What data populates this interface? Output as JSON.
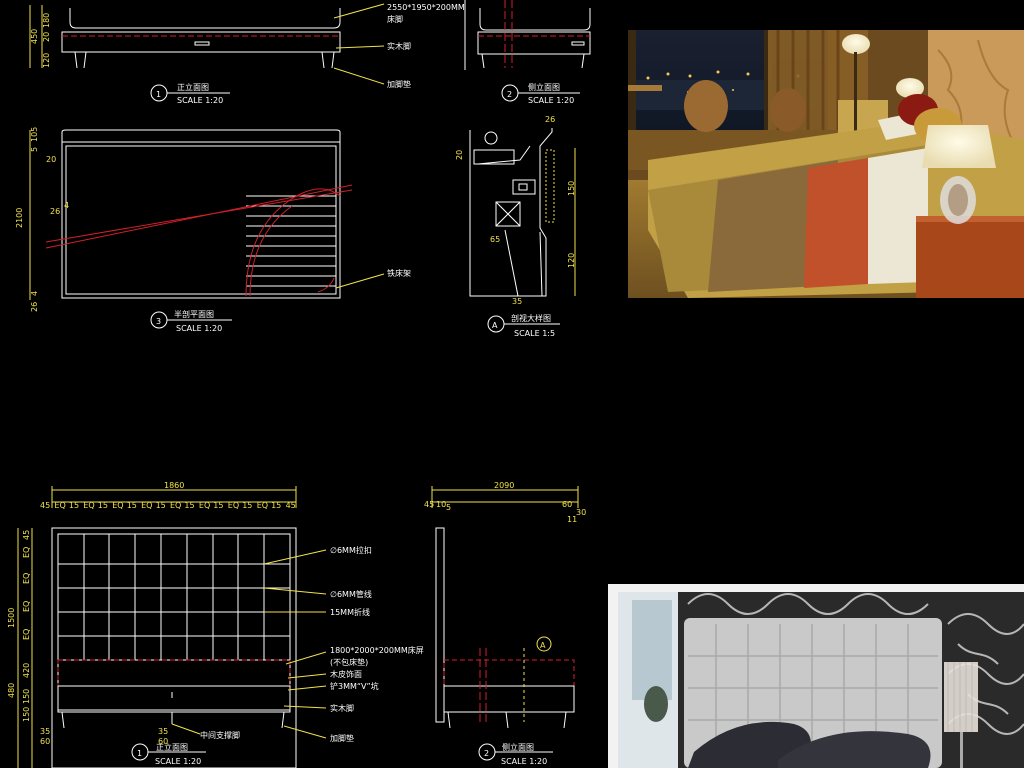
{
  "top_cad": {
    "dims_left_top": [
      "450",
      "120",
      "180",
      "20"
    ],
    "dims_left_mid": [
      "5",
      "105",
      "20",
      "2100",
      "26",
      "4",
      "26",
      "4"
    ],
    "callouts": {
      "size": "2550*1950*200MM",
      "foot": "床脚",
      "solid_leg": "实木脚",
      "pad": "加脚垫",
      "iron_frame": "铁床架"
    },
    "titles": [
      {
        "num": "1",
        "name": "正立面图",
        "scale": "SCALE 1:20"
      },
      {
        "num": "2",
        "name": "侧立面图",
        "scale": "SCALE 1:20"
      },
      {
        "num": "3",
        "name": "半剖平面图",
        "scale": "SCALE 1:20"
      },
      {
        "num": "A",
        "name": "剖视大样图",
        "scale": "SCALE 1:5"
      }
    ],
    "detail_dims": {
      "a": "26",
      "b": "20",
      "c": "150",
      "d": "120",
      "e": "65",
      "f": "35"
    }
  },
  "bottom_cad": {
    "overall_width": "1860",
    "overall_side": "2090",
    "top_row": [
      "45",
      "EQ",
      "15",
      "EQ",
      "15",
      "EQ",
      "15",
      "EQ",
      "15",
      "EQ",
      "15",
      "EQ",
      "15",
      "EQ",
      "15",
      "EQ",
      "15",
      "45"
    ],
    "side_top": [
      "45",
      "10",
      "5",
      "60",
      "30",
      "11"
    ],
    "left_dims": [
      "45",
      "EQ",
      "EQ",
      "EQ",
      "EQ",
      "1500",
      "420",
      "480",
      "150",
      "150",
      "35",
      "60"
    ],
    "bottom_dims": [
      "35",
      "60"
    ],
    "callouts": {
      "pull": "∅6MM拉扣",
      "piping": "∅6MM管线",
      "fold": "15MM折线",
      "size": "1800*2000*200MM床屏",
      "note": "(不包床垫)",
      "veneer": "木皮饰面",
      "groove": "铲3MM“V”坑",
      "solid_leg": "实木脚",
      "mid_leg": "中间支撑脚",
      "pad": "加脚垫",
      "marker": "A"
    },
    "titles": [
      {
        "num": "1",
        "name": "正立面图",
        "scale": "SCALE 1:20"
      },
      {
        "num": "2",
        "name": "侧立面图",
        "scale": "SCALE 1:20"
      }
    ]
  },
  "colors": {
    "cad_bg": "#000000",
    "cad_line": "#ffffff",
    "dim": "#f0e24a",
    "section": "#d0202a",
    "accent_cyan": "#46c8e0"
  }
}
